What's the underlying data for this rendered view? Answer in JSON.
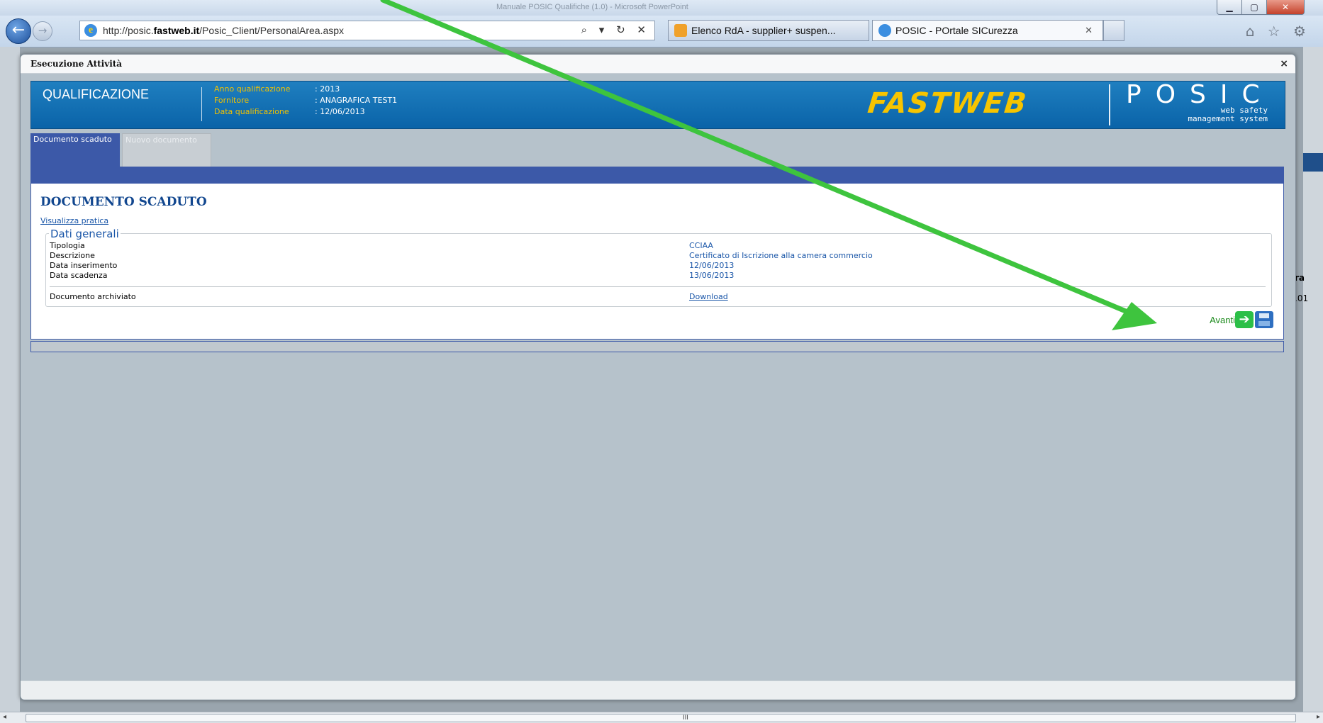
{
  "browser": {
    "window_title": "Manuale POSIC Qualifiche (1.0) - Microsoft PowerPoint",
    "url_prefix": "http://posic.",
    "url_domain": "fastweb.it",
    "url_path": "/Posic_Client/PersonalArea.aspx",
    "address_tools": "⌕ ▾ ↻ ✕",
    "tabs": [
      {
        "label": "Elenco RdA - supplier+ suspen..."
      },
      {
        "label": "POSIC - POrtale SICurezza"
      }
    ],
    "tab_close": "✕",
    "toolbar_icons": "⌂ ☆ ⚙"
  },
  "background_page": {
    "col_header": "ra",
    "cell_value": ".01"
  },
  "modal": {
    "title": "Esecuzione Attività",
    "close": "×",
    "banner": {
      "title": "QUALIFICAZIONE",
      "fields": [
        {
          "key": "Anno qualificazione",
          "value": ": 2013"
        },
        {
          "key": "Fornitore",
          "value": ": ANAGRAFICA TEST1"
        },
        {
          "key": "Data qualificazione",
          "value": ": 12/06/2013"
        }
      ],
      "fastweb_logo": "FASTWEB",
      "posic_logo": "POSIC",
      "posic_sub1": "web safety",
      "posic_sub2": "management system"
    },
    "tabs": [
      {
        "label": "Documento scaduto"
      },
      {
        "label": "Nuovo documento"
      }
    ],
    "content": {
      "heading": "DOCUMENTO SCADUTO",
      "link": "Visualizza pratica",
      "legend": "Dati generali",
      "rows": [
        {
          "label": "Tipologia",
          "value": "CCIAA"
        },
        {
          "label": "Descrizione",
          "value": "Certificato di Iscrizione alla camera commercio"
        },
        {
          "label": "Data inserimento",
          "value": "12/06/2013"
        },
        {
          "label": "Data scadenza",
          "value": "13/06/2013"
        }
      ],
      "archived_label": "Documento archiviato",
      "archived_link": "Download",
      "avanti": "Avanti"
    }
  },
  "scrollbar": {
    "left": "◂",
    "right": "▸",
    "grip": "III"
  },
  "colors": {
    "accent": "#3c59a8",
    "banner": "#0a63a8",
    "arrow": "#3ec43e",
    "fastweb_yellow": "#f6c400"
  },
  "icons": [
    "back-arrow-icon",
    "forward-arrow-icon",
    "ie-icon",
    "home-icon",
    "star-icon",
    "gear-icon",
    "next-arrow-icon",
    "save-icon"
  ]
}
